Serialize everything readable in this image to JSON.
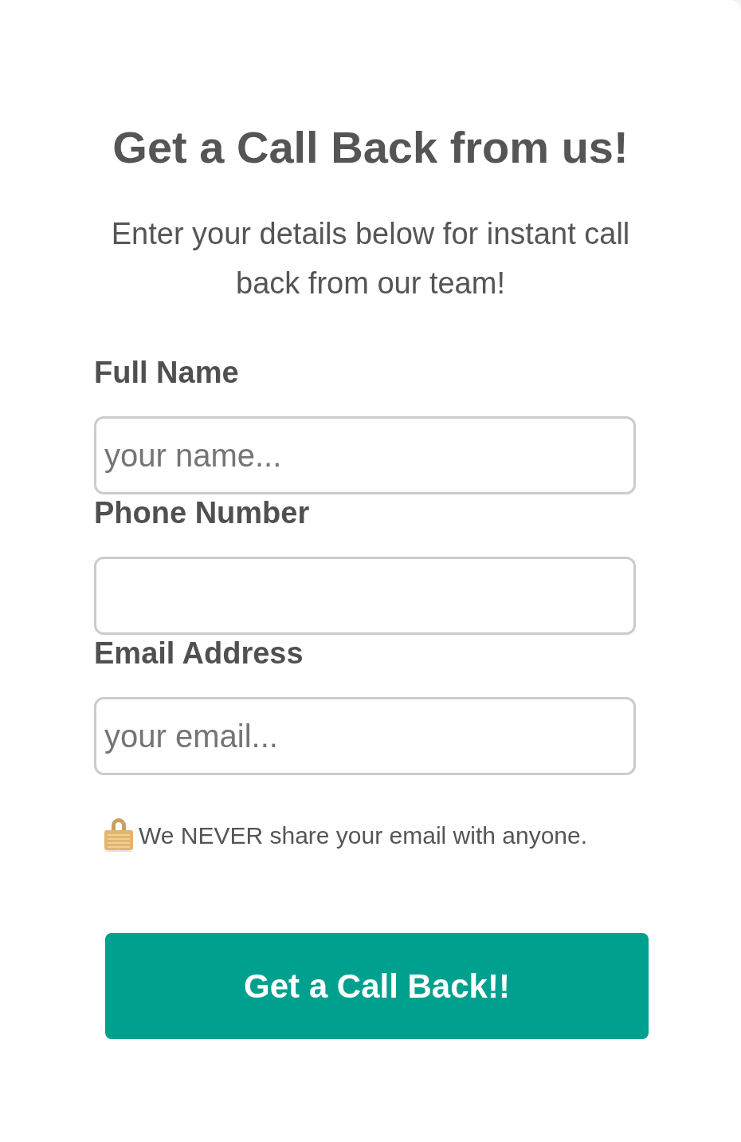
{
  "title": "Get a Call Back from us!",
  "subtitle": "Enter your details below for instant call back from our team!",
  "fields": [
    {
      "label": "Full Name",
      "placeholder": "your name..."
    },
    {
      "label": "Phone Number"
    },
    {
      "label": "Email Address",
      "placeholder": "your email..."
    }
  ],
  "privacy_note": "We NEVER share your email with anyone.",
  "submit_button": "Get a Call Back!!"
}
